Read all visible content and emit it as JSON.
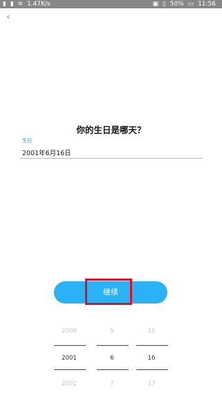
{
  "status_bar": {
    "network_speed": "1.47K/s",
    "battery": "50%",
    "time": "11:56",
    "left_icons": [
      "signal-icon",
      "signal-icon",
      "wifi-icon"
    ],
    "right_icons": [
      "nfc-icon",
      "vibrate-icon",
      "battery-icon"
    ]
  },
  "nav": {
    "back_icon": "‹"
  },
  "page": {
    "title": "你的生日是哪天？",
    "field_label": "生日",
    "field_value": "2001年6月16日"
  },
  "continue_label": "继续",
  "picker": {
    "year": {
      "prev": "2000",
      "selected": "2001",
      "next": "2002"
    },
    "month": {
      "prev": "5",
      "selected": "6",
      "next": "7"
    },
    "day": {
      "prev": "15",
      "selected": "16",
      "next": "17"
    }
  },
  "colors": {
    "status_bar_bg": "#878787",
    "accent": "#1aa3d7",
    "button": "#2bb1f5",
    "highlight": "#e0101a"
  }
}
